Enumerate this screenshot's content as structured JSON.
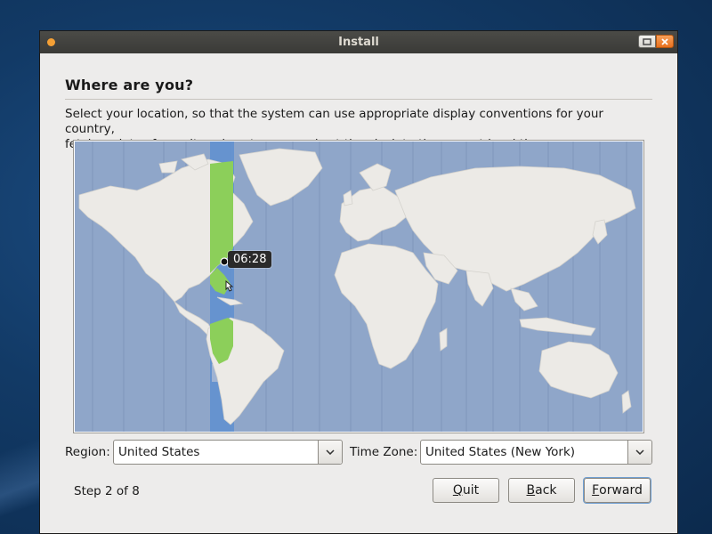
{
  "window": {
    "title": "Install"
  },
  "page": {
    "heading": "Where are you?",
    "description": "Select your location, so that the system can use appropriate display conventions for your country,\nfetch updates from sites close to you, and set the clock to the correct local time."
  },
  "map": {
    "selected_time": "06:28",
    "ocean_color": "#8fa6c9",
    "land_color": "#eceae6",
    "highlight_color": "#8ccf5a",
    "tz_band_color": "#5f8fd0"
  },
  "fields": {
    "region_label": "Region:",
    "region_value": "United States",
    "timezone_label": "Time Zone:",
    "timezone_value": "United States (New York)"
  },
  "footer": {
    "step_text": "Step 2 of 8",
    "quit_mnemonic": "Q",
    "quit_rest": "uit",
    "back_mnemonic": "B",
    "back_rest": "ack",
    "forward_mnemonic": "F",
    "forward_rest": "orward"
  }
}
